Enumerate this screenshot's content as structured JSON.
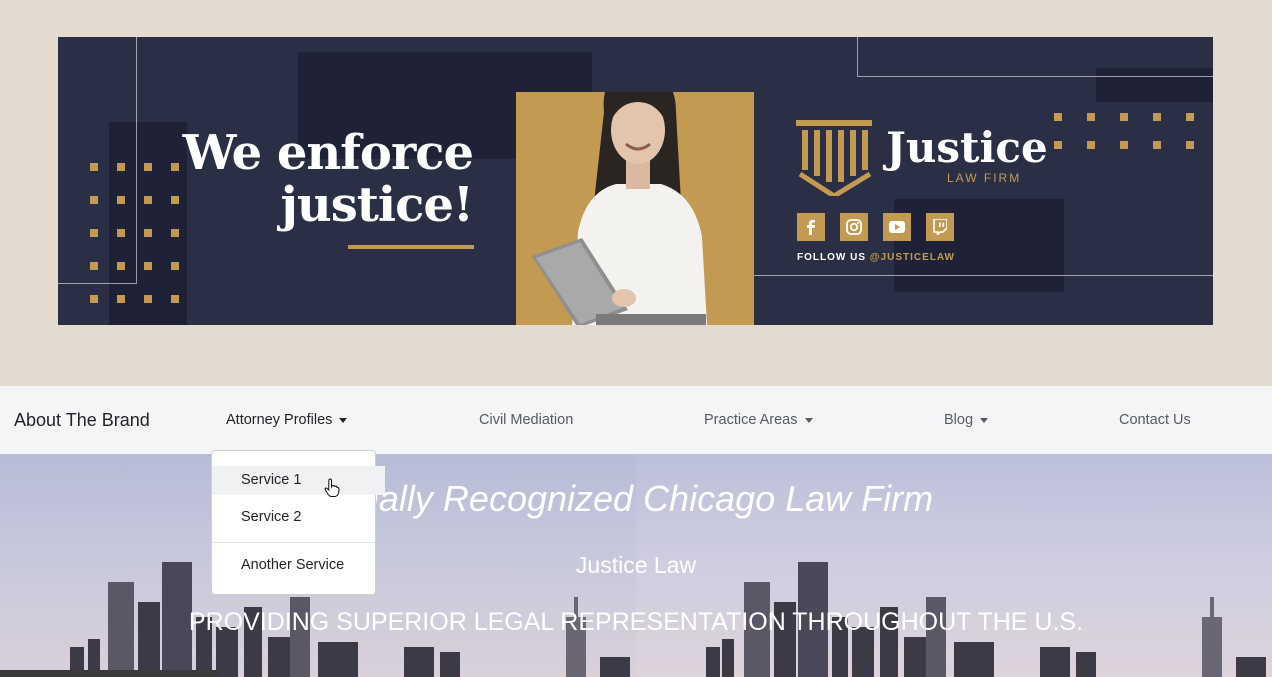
{
  "banner": {
    "tagline_line1": "We enforce",
    "tagline_line2": "justice!",
    "brand_name": "Justice",
    "brand_sub": "LAW FIRM",
    "follow_label": "FOLLOW US",
    "follow_handle": "@JUSTICELAW",
    "socials": [
      "facebook-icon",
      "instagram-icon",
      "youtube-icon",
      "twitch-icon"
    ],
    "colors": {
      "navy": "#2b2f45",
      "gold": "#c29a52"
    }
  },
  "navbar": {
    "brand": "About The Brand",
    "items": [
      {
        "label": "Attorney Profiles",
        "dropdown": true
      },
      {
        "label": "Civil Mediation",
        "dropdown": false
      },
      {
        "label": "Practice Areas",
        "dropdown": true
      },
      {
        "label": "Blog",
        "dropdown": true
      },
      {
        "label": "Contact Us",
        "dropdown": false
      }
    ]
  },
  "dropdown": {
    "items": [
      "Service 1",
      "Service 2",
      "Another Service"
    ]
  },
  "hero": {
    "title": "onally Recognized Chicago Law Firm",
    "subtitle": "Justice Law",
    "tagline": "PROVIDING SUPERIOR LEGAL REPRESENTATION THROUGHOUT THE U.S."
  }
}
